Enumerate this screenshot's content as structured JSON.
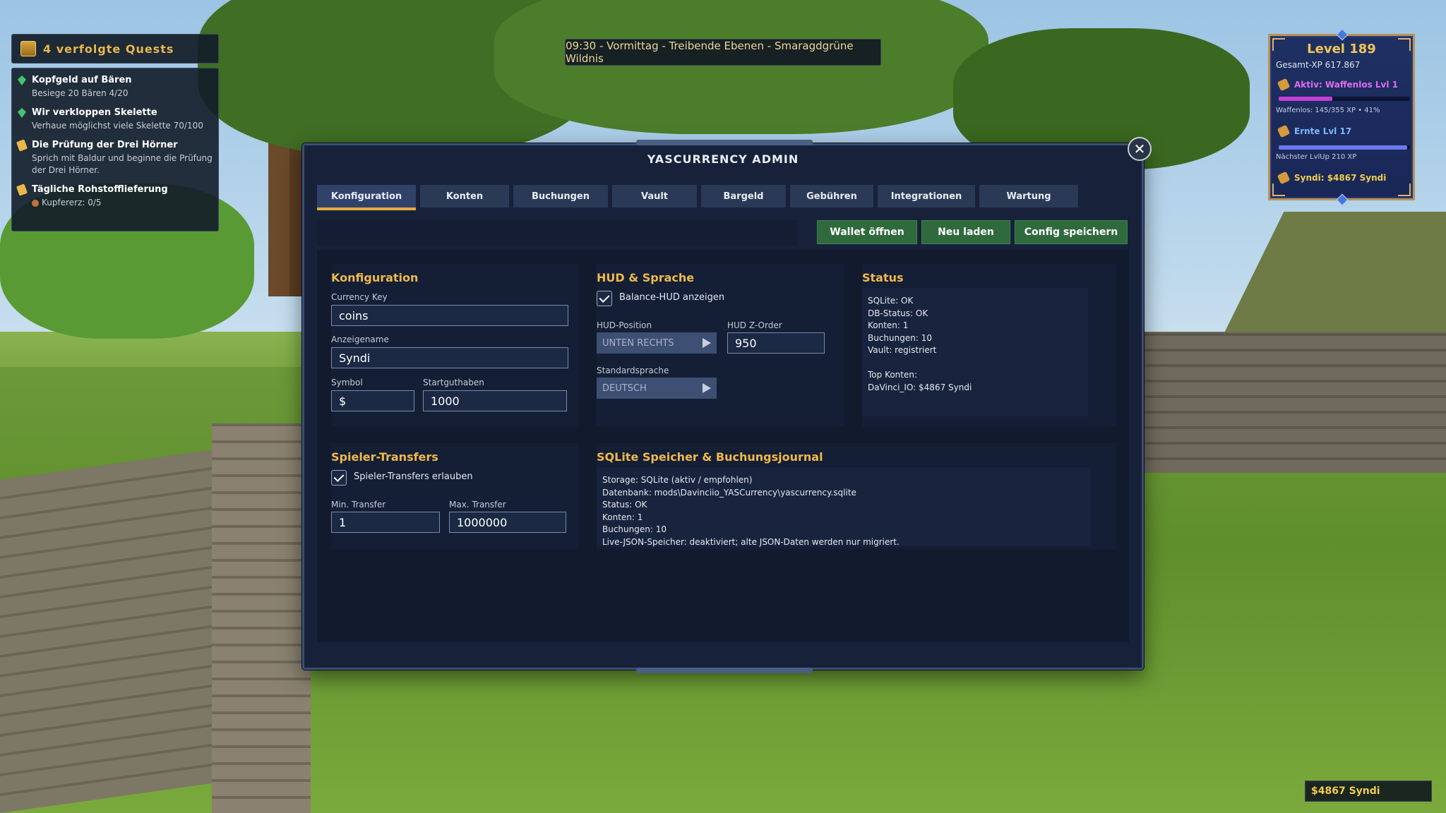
{
  "quests": {
    "header": "4 verfolgte Quests",
    "items": [
      {
        "title": "Kopfgeld auf Bären",
        "sub": "Besiege 20 Bären 4/20",
        "icon": "crystal-icon"
      },
      {
        "title": "Wir verkloppen Skelette",
        "sub": "Verhaue möglichst viele Skelette 70/100",
        "icon": "crystal-icon"
      },
      {
        "title": "Die Prüfung der Drei Hörner",
        "sub": "Sprich mit Baldur und beginne die Prüfung der Drei Hörner.",
        "icon": "scroll-icon"
      },
      {
        "title": "Tägliche Rohstofflieferung",
        "sub": "Kupfererz: 0/5",
        "icon": "scroll-icon"
      }
    ]
  },
  "time_banner": "09:30 - Vormittag - Treibende Ebenen - Smaragdgrüne Wildnis",
  "level_panel": {
    "title": "Level 189",
    "total_xp": "Gesamt-XP 617.867",
    "active_skill": "Aktiv: Waffenlos Lvl 1",
    "active_progress": 0.41,
    "active_note": "Waffenlos: 145/355 XP • 41%",
    "harvest_skill": "Ernte Lvl 17",
    "harvest_progress": 0.98,
    "harvest_note": "Nächster LvlUp 210 XP",
    "money": "Syndi: $4867 Syndi"
  },
  "money_box": "$4867 Syndi",
  "window": {
    "title": "YASCURRENCY ADMIN",
    "tabs": [
      "Konfiguration",
      "Konten",
      "Buchungen",
      "Vault",
      "Bargeld",
      "Gebühren",
      "Integrationen",
      "Wartung"
    ],
    "active_tab": "Konfiguration",
    "buttons": {
      "wallet": "Wallet öffnen",
      "reload": "Neu laden",
      "save": "Config speichern"
    },
    "config": {
      "title": "Konfiguration",
      "currency_key_label": "Currency Key",
      "currency_key": "coins",
      "display_name_label": "Anzeigename",
      "display_name": "Syndi",
      "symbol_label": "Symbol",
      "symbol": "$",
      "start_label": "Startguthaben",
      "start": "1000"
    },
    "hud": {
      "title": "HUD & Sprache",
      "balance_hud_label": "Balance-HUD anzeigen",
      "position_label": "HUD-Position",
      "position": "UNTEN RECHTS",
      "zorder_label": "HUD Z-Order",
      "zorder": "950",
      "language_label": "Standardsprache",
      "language": "DEUTSCH"
    },
    "status": {
      "title": "Status",
      "lines": [
        "SQLite: OK",
        "DB-Status: OK",
        "Konten: 1",
        "Buchungen: 10",
        "Vault: registriert",
        "",
        "Top Konten:",
        "DaVinci_IO: $4867 Syndi"
      ]
    },
    "transfers": {
      "title": "Spieler-Transfers",
      "allow_label": "Spieler-Transfers erlauben",
      "min_label": "Min. Transfer",
      "min": "1",
      "max_label": "Max. Transfer",
      "max": "1000000"
    },
    "sqlite": {
      "title": "SQLite Speicher & Buchungsjournal",
      "lines": [
        "Storage: SQLite (aktiv / empfohlen)",
        "Datenbank: mods\\Davinciio_YASCurrency\\yascurrency.sqlite",
        "Status: OK",
        "Konten: 1",
        "Buchungen: 10",
        "Live-JSON-Speicher: deaktiviert; alte JSON-Daten werden nur migriert."
      ]
    }
  }
}
